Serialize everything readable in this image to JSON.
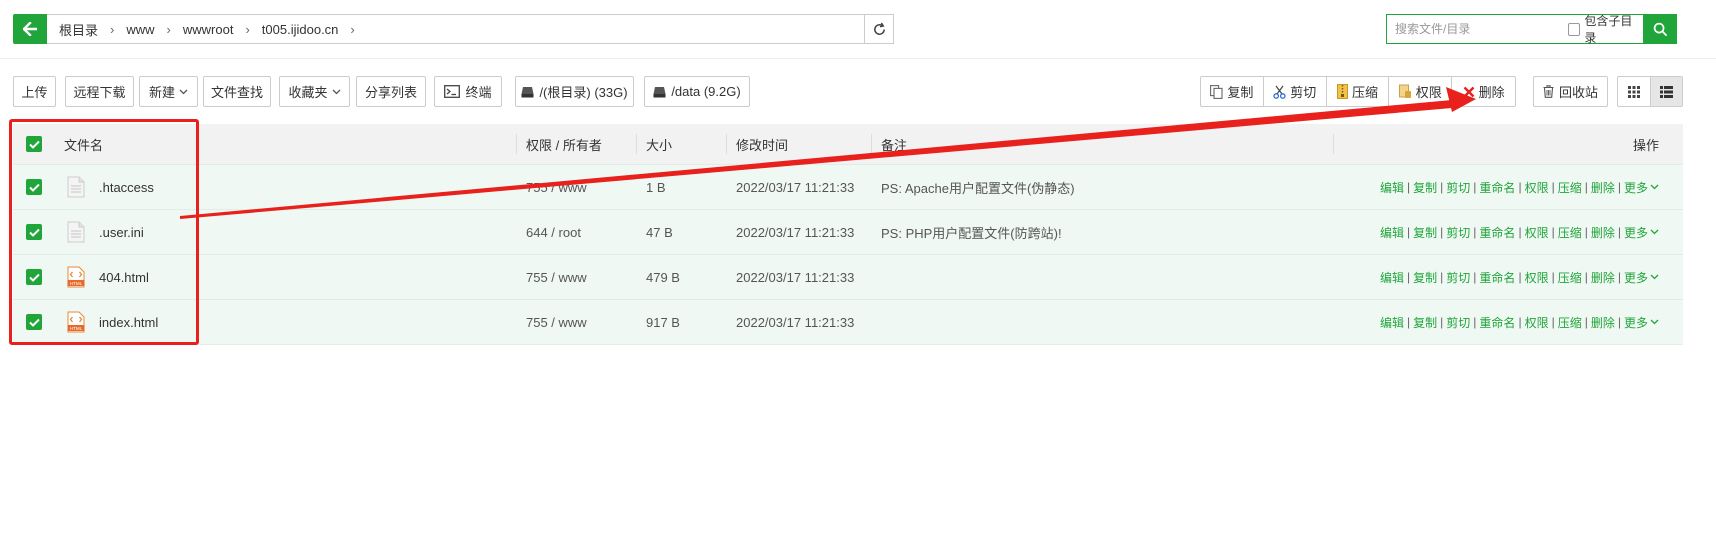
{
  "pathbar": {
    "crumbs": [
      "根目录",
      "www",
      "wwwroot",
      "t005.ijidoo.cn"
    ]
  },
  "search": {
    "placeholder": "搜索文件/目录",
    "subdir_label": "包含子目录"
  },
  "toolbar": {
    "upload": "上传",
    "remote_download": "远程下载",
    "new": "新建",
    "file_search": "文件查找",
    "favorites": "收藏夹",
    "share_list": "分享列表",
    "terminal": "终端",
    "disk_root": "/(根目录) (33G)",
    "disk_data": "/data (9.2G)",
    "copy": "复制",
    "cut": "剪切",
    "compress": "压缩",
    "permission": "权限",
    "delete": "删除",
    "recycle_bin": "回收站"
  },
  "table": {
    "headers": {
      "name": "文件名",
      "perm_owner": "权限 / 所有者",
      "size": "大小",
      "mtime": "修改时间",
      "remark": "备注",
      "ops": "操作"
    },
    "ops": {
      "edit": "编辑",
      "copy": "复制",
      "cut": "剪切",
      "rename": "重命名",
      "permission": "权限",
      "compress": "压缩",
      "delete": "删除",
      "more": "更多"
    },
    "rows": [
      {
        "name": ".htaccess",
        "perm": "755 / www",
        "size": "1 B",
        "mtime": "2022/03/17 11:21:33",
        "remark": "PS: Apache用户配置文件(伪静态)",
        "icon": "text-file-icon"
      },
      {
        "name": ".user.ini",
        "perm": "644 / root",
        "size": "47 B",
        "mtime": "2022/03/17 11:21:33",
        "remark": "PS: PHP用户配置文件(防跨站)!",
        "icon": "text-file-icon"
      },
      {
        "name": "404.html",
        "perm": "755 / www",
        "size": "479 B",
        "mtime": "2022/03/17 11:21:33",
        "remark": "",
        "icon": "html-file-icon"
      },
      {
        "name": "index.html",
        "perm": "755 / www",
        "size": "917 B",
        "mtime": "2022/03/17 11:21:33",
        "remark": "",
        "icon": "html-file-icon"
      }
    ]
  },
  "colors": {
    "accent": "#20a53a",
    "annotation": "#e8211d",
    "row_bg": "#f0f8f4"
  }
}
